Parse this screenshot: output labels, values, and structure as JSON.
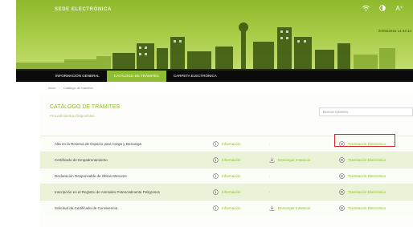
{
  "header": {
    "brand": "SEDE ELECTRÓNICA",
    "icons": [
      "wifi-icon",
      "contrast-icon",
      "font-size-icon"
    ],
    "font_size_label": "A⁺",
    "datetime": "20/05/2016 14:34:14",
    "colors": {
      "header_green": "#8fb92d",
      "accent": "#8ebd34",
      "highlight": "#e0242b"
    }
  },
  "nav": {
    "tabs": [
      {
        "label": "INFORMACIÓN GENERAL"
      },
      {
        "label": "CATÁLOGO DE TRÁMITES"
      },
      {
        "label": "CARPETA ELECTRÓNICA"
      }
    ]
  },
  "breadcrumb": {
    "home": "Inicio",
    "sep": "›",
    "current": "Catálogo de trámites"
  },
  "main": {
    "title": "CATÁLOGO DE TRÁMITES",
    "subtitle": "Procedimientos Disponibles",
    "search_placeholder": "Buscar trámites"
  },
  "procedures": [
    {
      "name": "Alta en la Reserva de Espacio para Carga y Descarga",
      "info": "Información",
      "download": "-",
      "tramitacion": "Tramitación Electrónica"
    },
    {
      "name": "Certificado de Empadronamiento",
      "info": "Información",
      "download": "Descargar Instancia",
      "tramitacion": "Tramitación Electrónica"
    },
    {
      "name": "Declaración Responsable de Obras Menores",
      "info": "Información",
      "download": "-",
      "tramitacion": "Tramitación Electrónica"
    },
    {
      "name": "Inscripción en el Registro de Animales Potencialmente Peligrosos",
      "info": "Información",
      "download": "-",
      "tramitacion": "Tramitación Electrónica"
    },
    {
      "name": "Solicitud de Certificado de Convivencia",
      "info": "Información",
      "download": "Descargar Instancia",
      "tramitacion": "Tramitación Electrónica"
    }
  ]
}
